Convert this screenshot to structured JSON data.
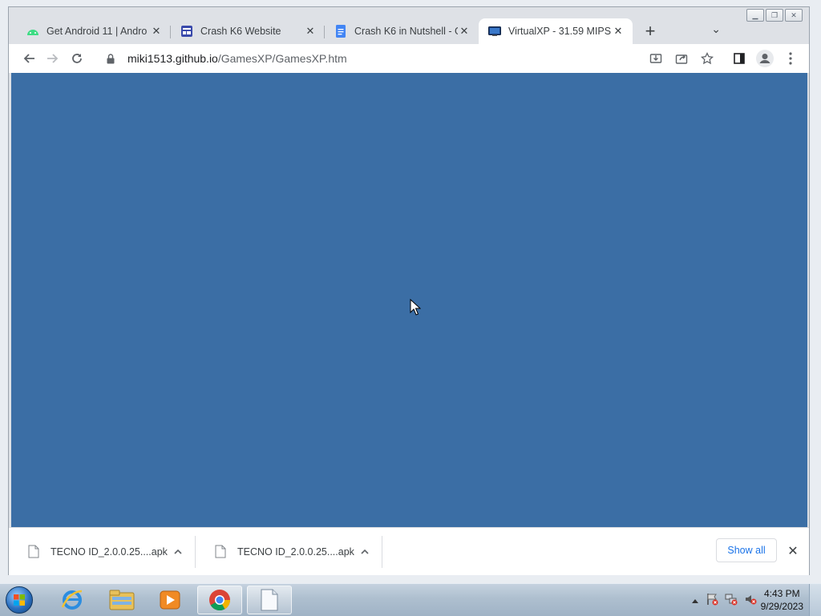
{
  "browser": {
    "tabs": [
      {
        "title": "Get Android 11 | Andro",
        "icon": "android-icon",
        "active": false
      },
      {
        "title": "Crash K6 Website",
        "icon": "sites-icon",
        "active": false
      },
      {
        "title": "Crash K6 in Nutshell - G",
        "icon": "docs-icon",
        "active": false
      },
      {
        "title": "VirtualXP - 31.59 MIPS",
        "icon": "virtualxp-icon",
        "active": true
      }
    ],
    "new_tab_symbol": "+",
    "tab_search_symbol": "⌄",
    "url_host": "miki1513.github.io",
    "url_path": "/GamesXP/GamesXP.htm"
  },
  "page": {
    "background": "#3b6ea5"
  },
  "downloads": {
    "items": [
      {
        "name": "TECNO ID_2.0.0.25....apk"
      },
      {
        "name": "TECNO ID_2.0.0.25....apk"
      }
    ],
    "show_all_label": "Show all"
  },
  "taskbar": {
    "apps": [
      "start-orb",
      "internet-explorer-icon",
      "windows-explorer-icon",
      "media-player-icon",
      "chrome-icon",
      "notepad-icon"
    ],
    "clock_time": "4:43 PM",
    "clock_date": "9/29/2023"
  },
  "colors": {
    "accent": "#1a73e8",
    "tab_strip": "#dee1e6",
    "page_blue": "#3b6ea5"
  }
}
